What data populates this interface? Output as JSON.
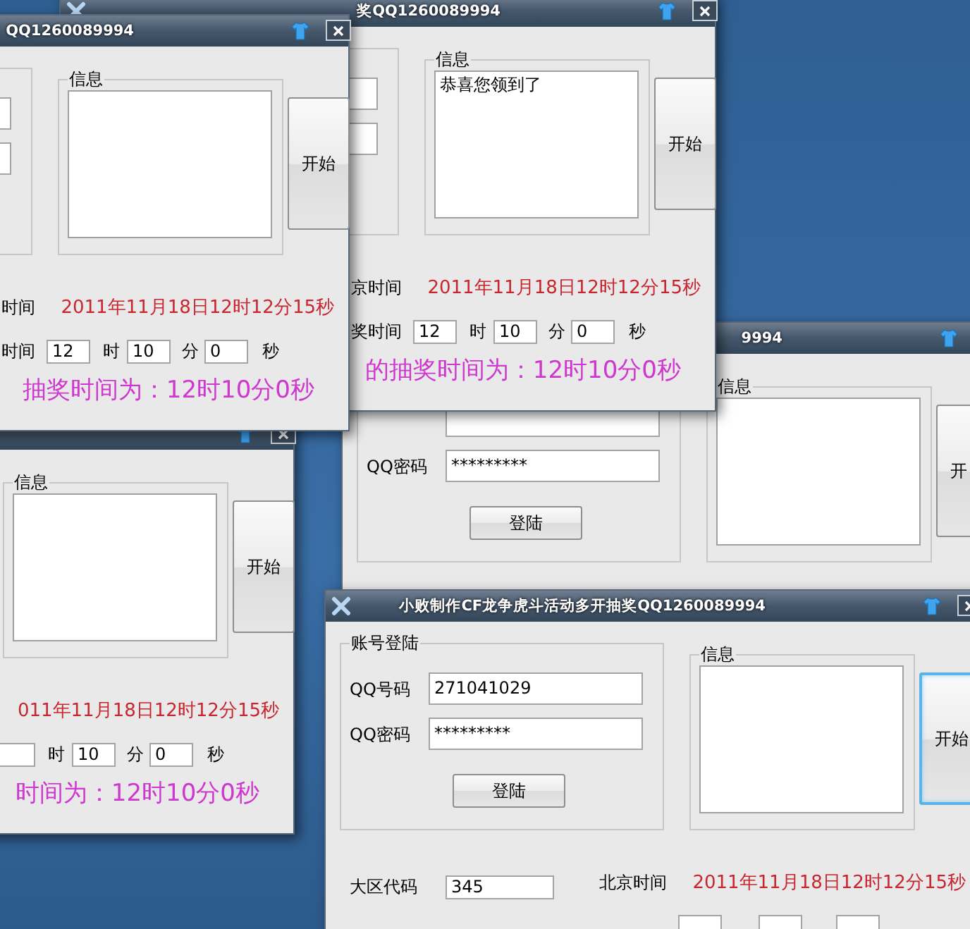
{
  "windows": [
    {
      "title": "9994",
      "login": {
        "pwd_label": "QQ密码",
        "pwd_value": "*********",
        "button": "登陆"
      },
      "info": {
        "legend": "信息"
      },
      "start_button": {
        "label": "开",
        "focused": false
      }
    },
    {
      "title": "奖QQ1260089994",
      "info": {
        "legend": "信息",
        "text": "恭喜您领到了"
      },
      "start_button": {
        "label": "开始",
        "focused": false
      },
      "beijing_label": "京时间",
      "time": "2011年11月18日12时12分15秒",
      "draw_label": "奖时间",
      "hour": "12",
      "hour_unit": "时",
      "minute": "10",
      "minute_unit": "分",
      "second": "0",
      "second_unit": "秒",
      "message": "的抽奖时间为：12时10分0秒"
    },
    {
      "title": "QQ1260089994",
      "info": {
        "legend": "信息"
      },
      "start_button": {
        "label": "开始",
        "focused": false
      },
      "beijing_label": "时间",
      "time": "2011年11月18日12时12分15秒",
      "draw_label": "时间",
      "hour": "12",
      "hour_unit": "时",
      "minute": "10",
      "minute_unit": "分",
      "second": "0",
      "second_unit": "秒",
      "message": "抽奖时间为：12时10分0秒"
    },
    {
      "info": {
        "legend": "信息"
      },
      "start_button": {
        "label": "开始",
        "focused": false
      },
      "time": "011年11月18日12时12分15秒",
      "hour_unit": "时",
      "minute": "10",
      "minute_unit": "分",
      "second": "0",
      "second_unit": "秒",
      "message": "时间为：12时10分0秒"
    },
    {
      "title": "小败制作CF龙争虎斗活动多开抽奖QQ1260089994",
      "login": {
        "legend": "账号登陆",
        "qq_label": "QQ号码",
        "qq_value": "271041029",
        "pwd_label": "QQ密码",
        "pwd_value": "*********",
        "button": "登陆"
      },
      "info": {
        "legend": "信息"
      },
      "start_button": {
        "label": "开始",
        "focused": true
      },
      "area_label": "大区代码",
      "area_value": "345",
      "beijing_label": "北京时间",
      "time": "2011年11月18日12时12分15秒"
    }
  ]
}
